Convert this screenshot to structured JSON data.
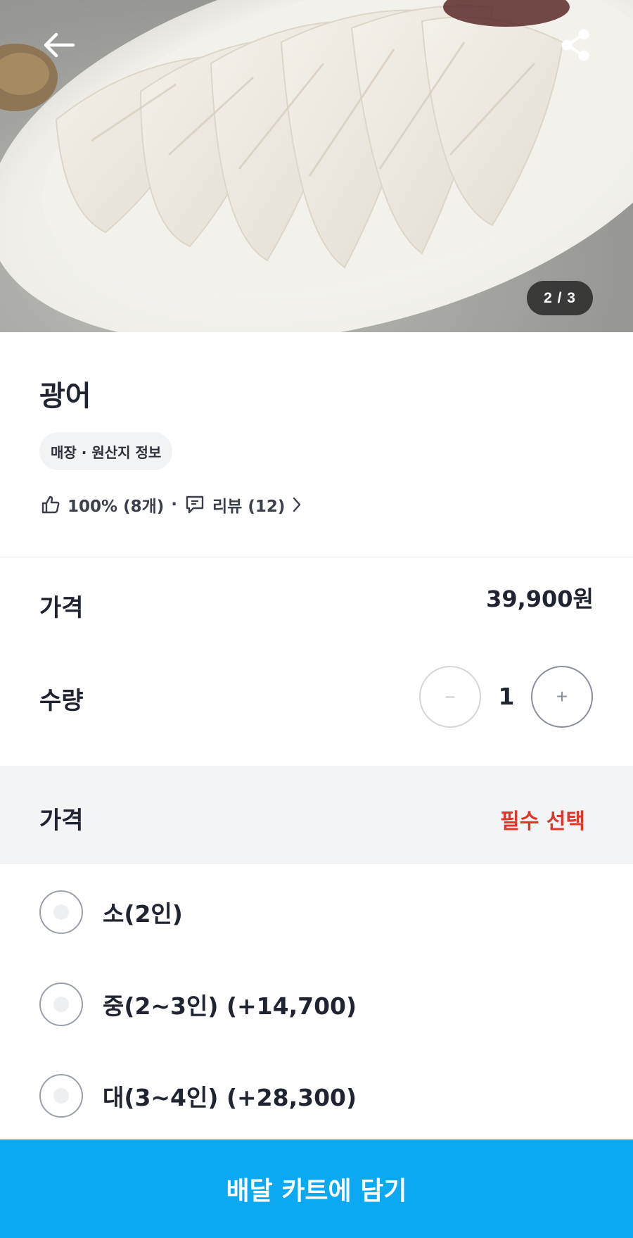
{
  "hero": {
    "page_indicator": "2 / 3",
    "back_icon": "arrow-left-icon",
    "share_icon": "share-icon"
  },
  "product": {
    "title": "광어",
    "info_chip": "매장 · 원산지 정보",
    "rating": "100% (8개)",
    "separator": "·",
    "reviews": "리뷰 (12)"
  },
  "price": {
    "label": "가격",
    "value": "39,900원"
  },
  "quantity": {
    "label": "수량",
    "value": "1",
    "minus": "−",
    "plus": "+"
  },
  "options": {
    "header": "가격",
    "required": "필수 선택",
    "items": [
      {
        "label": "소(2인)"
      },
      {
        "label": "중(2~3인) (+14,700)"
      },
      {
        "label": "대(3~4인) (+28,300)"
      }
    ]
  },
  "cta": {
    "label": "배달 카트에 담기"
  },
  "colors": {
    "accent": "#0aa9f2",
    "required": "#e0352b",
    "text": "#1f2430"
  }
}
